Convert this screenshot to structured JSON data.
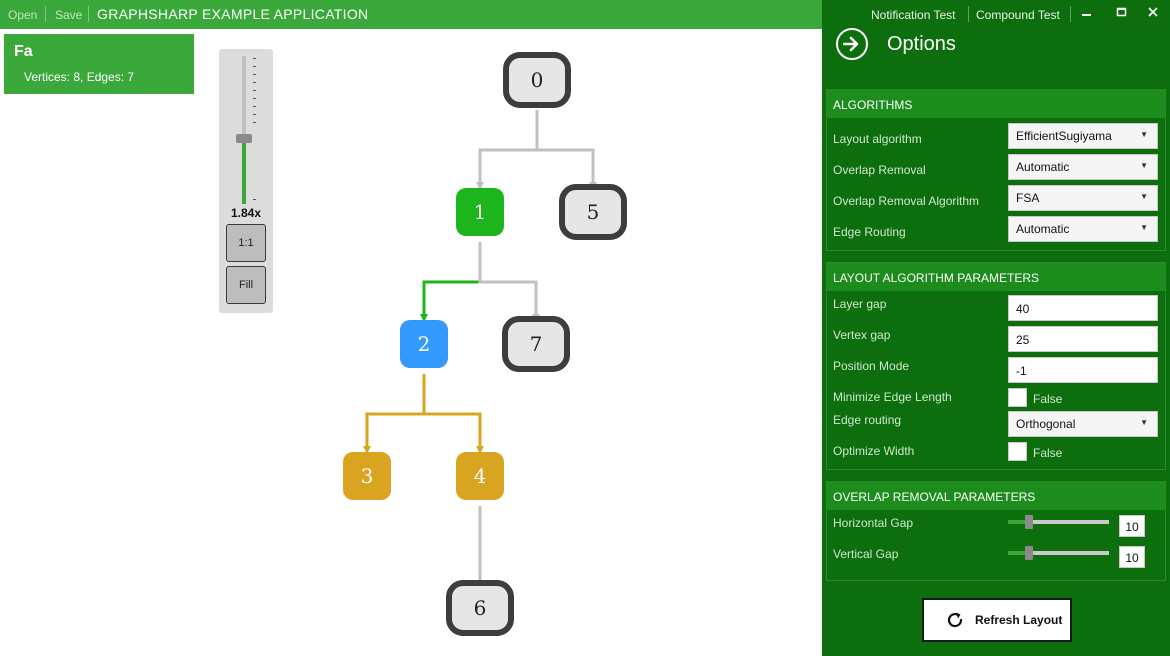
{
  "toolbar": {
    "open_label": "Open",
    "save_label": "Save",
    "app_title": "GRAPHSHARP EXAMPLE APPLICATION"
  },
  "info": {
    "title": "Fa",
    "summary": "Vertices: 8, Edges: 7"
  },
  "zoom": {
    "value_label": "1.84x",
    "level": 0.44,
    "one_to_one_label": "1:1",
    "fill_label": "Fill"
  },
  "graph": {
    "vertices": [
      {
        "id": "0",
        "label": "0",
        "state": "normal"
      },
      {
        "id": "1",
        "label": "1",
        "state": "selected"
      },
      {
        "id": "5",
        "label": "5",
        "state": "normal"
      },
      {
        "id": "2",
        "label": "2",
        "state": "highlighted"
      },
      {
        "id": "7",
        "label": "7",
        "state": "normal"
      },
      {
        "id": "3",
        "label": "3",
        "state": "child"
      },
      {
        "id": "4",
        "label": "4",
        "state": "child"
      },
      {
        "id": "6",
        "label": "6",
        "state": "normal"
      }
    ],
    "edges": [
      {
        "from": "0",
        "to": "1",
        "state": "normal"
      },
      {
        "from": "0",
        "to": "5",
        "state": "normal"
      },
      {
        "from": "1",
        "to": "2",
        "state": "selected"
      },
      {
        "from": "1",
        "to": "7",
        "state": "normal"
      },
      {
        "from": "2",
        "to": "3",
        "state": "child"
      },
      {
        "from": "2",
        "to": "4",
        "state": "child"
      },
      {
        "from": "4",
        "to": "6",
        "state": "normal"
      }
    ],
    "colors": {
      "normal_fill": "#e6e6e6",
      "normal_border": "#3d3d3d",
      "selected": "#1db51d",
      "highlighted": "#3399ff",
      "child": "#d9a520",
      "edge_normal": "#c0c0c0"
    }
  },
  "panel": {
    "notification_test": "Notification Test",
    "compound_test": "Compound Test",
    "minimize_icon": "minimize-icon",
    "maximize_icon": "maximize-icon",
    "close_icon": "close-icon",
    "options_title": "Options",
    "algorithms": {
      "header": "ALGORITHMS",
      "layout_algorithm_label": "Layout algorithm",
      "layout_algorithm_value": "EfficientSugiyama",
      "overlap_removal_label": "Overlap Removal",
      "overlap_removal_value": "Automatic",
      "overlap_removal_algorithm_label": "Overlap Removal Algorithm",
      "overlap_removal_algorithm_value": "FSA",
      "edge_routing_label": "Edge Routing",
      "edge_routing_value": "Automatic"
    },
    "layout_params": {
      "header": "LAYOUT ALGORITHM PARAMETERS",
      "layer_gap_label": "Layer gap",
      "layer_gap_value": "40",
      "vertex_gap_label": "Vertex gap",
      "vertex_gap_value": "25",
      "position_mode_label": "Position Mode",
      "position_mode_value": "-1",
      "minimize_edge_length_label": "Minimize Edge Length",
      "minimize_edge_length_value": "False",
      "edge_routing_label": "Edge routing",
      "edge_routing_value": "Orthogonal",
      "optimize_width_label": "Optimize Width",
      "optimize_width_value": "False"
    },
    "overlap_params": {
      "header": "OVERLAP REMOVAL PARAMETERS",
      "horizontal_gap_label": "Horizontal Gap",
      "horizontal_gap_value": "10",
      "horizontal_gap_level": 0.21,
      "vertical_gap_label": "Vertical Gap",
      "vertical_gap_value": "10",
      "vertical_gap_level": 0.21
    },
    "refresh_label": "Refresh Layout"
  }
}
